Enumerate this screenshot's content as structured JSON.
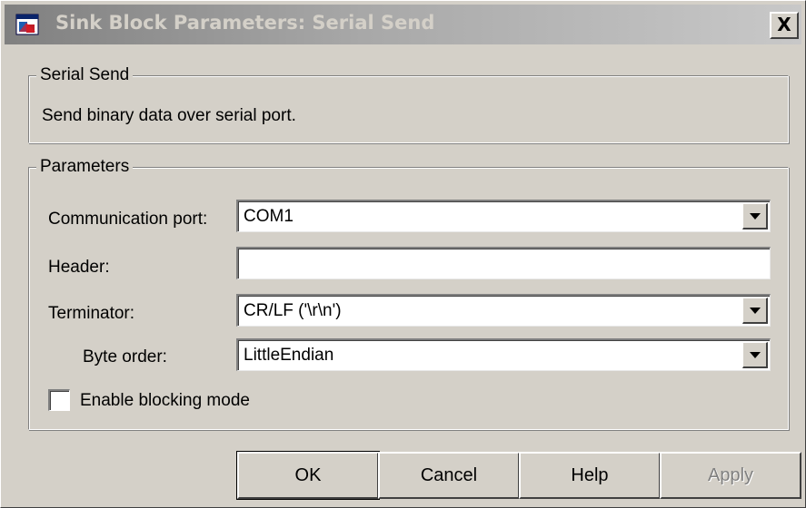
{
  "window": {
    "title": "Sink Block Parameters: Serial Send",
    "close_label": "X"
  },
  "description_group": {
    "label": "Serial Send",
    "text": "Send binary data over serial port."
  },
  "parameters_group": {
    "label": "Parameters",
    "communication_port": {
      "label": "Communication port:",
      "value": "COM1"
    },
    "header": {
      "label": "Header:",
      "value": ""
    },
    "terminator": {
      "label": "Terminator:",
      "value": "CR/LF ('\\r\\n')"
    },
    "byte_order": {
      "label": "Byte order:",
      "value": "LittleEndian"
    },
    "blocking_mode": {
      "label": "Enable blocking mode",
      "checked": false
    }
  },
  "buttons": {
    "ok": "OK",
    "cancel": "Cancel",
    "help": "Help",
    "apply": "Apply"
  },
  "icons": {
    "title": "simulink-block-icon",
    "dropdown": "chevron-down-icon"
  }
}
